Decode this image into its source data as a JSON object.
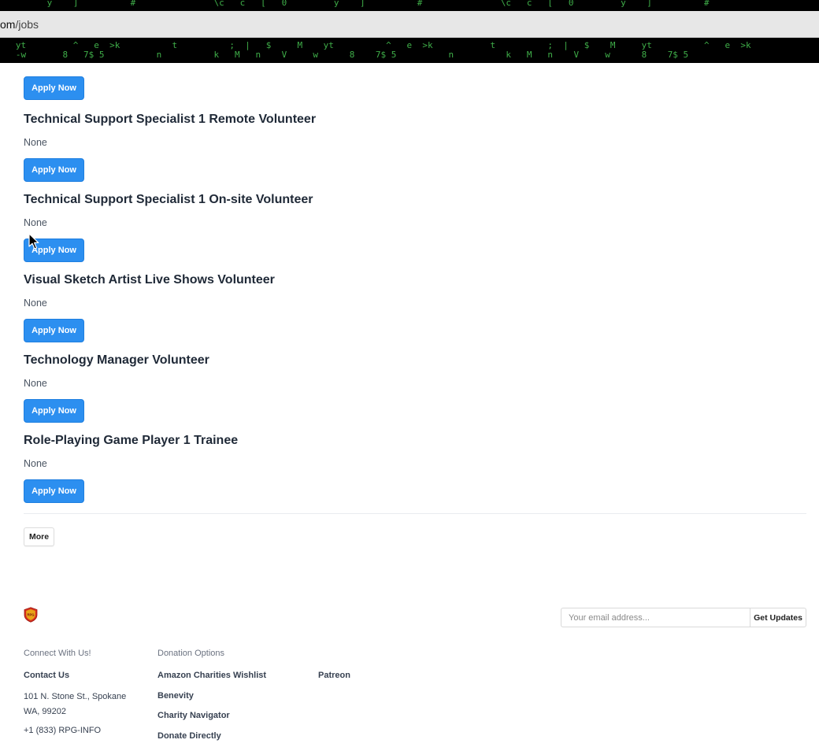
{
  "browser": {
    "url_host": "om",
    "url_path": "/jobs"
  },
  "matrix": {
    "rows": [
      {
        "text": "         y    ]          #               \\c   c   [   0         y    ]          #               \\c   c   [   0         y    ]          #"
      },
      {
        "text": "   -w       8   7$ 5          n          k   M   n    V     w      8    7$ 5          n          k   M   n    V     w      8    7$ 5"
      },
      {
        "text": "   yt         ^   e  >k          t          ;  |   $     M    yt          ^   e  >k           t          ;  |   $    M     yt          ^   e  >k"
      }
    ]
  },
  "jobs": [
    {
      "title": "",
      "description": "",
      "apply_label": "Apply Now"
    },
    {
      "title": "Technical Support Specialist 1 Remote Volunteer",
      "description": "None",
      "apply_label": "Apply Now"
    },
    {
      "title": "Technical Support Specialist 1 On-site Volunteer",
      "description": "None",
      "apply_label": "Apply Now"
    },
    {
      "title": "Visual Sketch Artist Live Shows Volunteer",
      "description": "None",
      "apply_label": "Apply Now"
    },
    {
      "title": "Technology Manager Volunteer",
      "description": "None",
      "apply_label": "Apply Now"
    },
    {
      "title": "Role-Playing Game Player 1 Trainee",
      "description": "None",
      "apply_label": "Apply Now"
    }
  ],
  "more_label": "More",
  "footer": {
    "logo_text": "RPG",
    "email_placeholder": "Your email address...",
    "subscribe_label": "Get Updates",
    "connect": {
      "heading": "Connect With Us!",
      "contact": "Contact Us",
      "address": "101 N. Stone St., Spokane WA, 99202",
      "phone": "+1 (833) RPG-INFO"
    },
    "donate": {
      "heading": "Donation Options",
      "col1": [
        "Amazon Charities Wishlist",
        "Benevity",
        "Charity Navigator",
        "Donate Directly"
      ],
      "col2": [
        "Patreon"
      ]
    }
  },
  "colors": {
    "primary_button": "#2c8ff0",
    "matrix_green": "#3fae49",
    "matrix_bg": "#000000"
  }
}
